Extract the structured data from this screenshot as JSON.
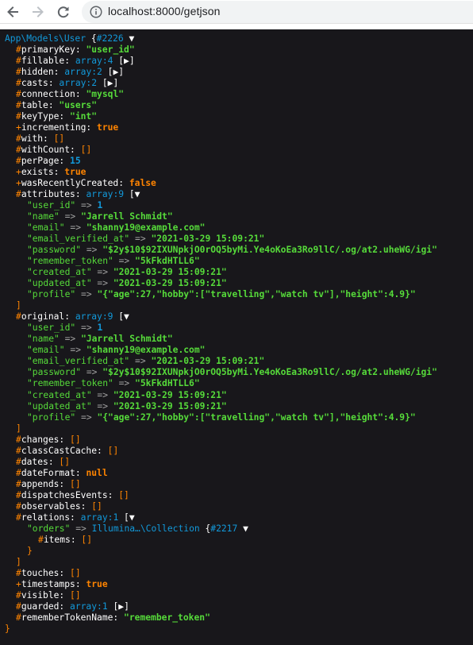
{
  "browser": {
    "url": "localhost:8000/getjson"
  },
  "colors": {
    "dump_bg": "#18171b",
    "string": "#56db3a",
    "constant": "#ff8400",
    "meta": "#1299da"
  },
  "lines": [
    {
      "i": 0,
      "s": [
        [
          "class",
          "App\\Models\\User"
        ],
        [
          "key",
          " {"
        ],
        [
          "meta",
          "#2226"
        ],
        [
          "toggle",
          " ▼"
        ]
      ]
    },
    {
      "i": 1,
      "s": [
        [
          "sym",
          "#"
        ],
        [
          "key",
          "primaryKey: "
        ],
        [
          "str",
          "\"user_id\""
        ]
      ]
    },
    {
      "i": 1,
      "s": [
        [
          "sym",
          "#"
        ],
        [
          "key",
          "fillable: "
        ],
        [
          "meta",
          "array:4"
        ],
        [
          "key",
          " ["
        ],
        [
          "toggle",
          "▶"
        ],
        [
          "key",
          "]"
        ]
      ]
    },
    {
      "i": 1,
      "s": [
        [
          "sym",
          "#"
        ],
        [
          "key",
          "hidden: "
        ],
        [
          "meta",
          "array:2"
        ],
        [
          "key",
          " ["
        ],
        [
          "toggle",
          "▶"
        ],
        [
          "key",
          "]"
        ]
      ]
    },
    {
      "i": 1,
      "s": [
        [
          "sym",
          "#"
        ],
        [
          "key",
          "casts: "
        ],
        [
          "meta",
          "array:2"
        ],
        [
          "key",
          " ["
        ],
        [
          "toggle",
          "▶"
        ],
        [
          "key",
          "]"
        ]
      ]
    },
    {
      "i": 1,
      "s": [
        [
          "sym",
          "#"
        ],
        [
          "key",
          "connection: "
        ],
        [
          "str",
          "\"mysql\""
        ]
      ]
    },
    {
      "i": 1,
      "s": [
        [
          "sym",
          "#"
        ],
        [
          "key",
          "table: "
        ],
        [
          "str",
          "\"users\""
        ]
      ]
    },
    {
      "i": 1,
      "s": [
        [
          "sym",
          "#"
        ],
        [
          "key",
          "keyType: "
        ],
        [
          "str",
          "\"int\""
        ]
      ]
    },
    {
      "i": 1,
      "s": [
        [
          "sym",
          "+"
        ],
        [
          "key",
          "incrementing: "
        ],
        [
          "const",
          "true"
        ]
      ]
    },
    {
      "i": 1,
      "s": [
        [
          "sym",
          "#"
        ],
        [
          "key",
          "with: "
        ],
        [
          "sym",
          "[]"
        ]
      ]
    },
    {
      "i": 1,
      "s": [
        [
          "sym",
          "#"
        ],
        [
          "key",
          "withCount: "
        ],
        [
          "sym",
          "[]"
        ]
      ]
    },
    {
      "i": 1,
      "s": [
        [
          "sym",
          "#"
        ],
        [
          "key",
          "perPage: "
        ],
        [
          "num",
          "15"
        ]
      ]
    },
    {
      "i": 1,
      "s": [
        [
          "sym",
          "+"
        ],
        [
          "key",
          "exists: "
        ],
        [
          "const",
          "true"
        ]
      ]
    },
    {
      "i": 1,
      "s": [
        [
          "sym",
          "+"
        ],
        [
          "key",
          "wasRecentlyCreated: "
        ],
        [
          "const",
          "false"
        ]
      ]
    },
    {
      "i": 1,
      "s": [
        [
          "sym",
          "#"
        ],
        [
          "key",
          "attributes: "
        ],
        [
          "meta",
          "array:9"
        ],
        [
          "key",
          " ["
        ],
        [
          "toggle",
          "▼"
        ]
      ]
    },
    {
      "i": 2,
      "s": [
        [
          "akey",
          "\"user_id\""
        ],
        [
          "arrow",
          " => "
        ],
        [
          "num",
          "1"
        ]
      ]
    },
    {
      "i": 2,
      "s": [
        [
          "akey",
          "\"name\""
        ],
        [
          "arrow",
          " => "
        ],
        [
          "str",
          "\"Jarrell Schmidt\""
        ]
      ]
    },
    {
      "i": 2,
      "s": [
        [
          "akey",
          "\"email\""
        ],
        [
          "arrow",
          " => "
        ],
        [
          "str",
          "\"shanny19@example.com\""
        ]
      ]
    },
    {
      "i": 2,
      "s": [
        [
          "akey",
          "\"email_verified_at\""
        ],
        [
          "arrow",
          " => "
        ],
        [
          "str",
          "\"2021-03-29 15:09:21\""
        ]
      ]
    },
    {
      "i": 2,
      "s": [
        [
          "akey",
          "\"password\""
        ],
        [
          "arrow",
          " => "
        ],
        [
          "str",
          "\"$2y$10$92IXUNpkjO0rOQ5byMi.Ye4oKoEa3Ro9llC/.og/at2.uheWG/igi\""
        ]
      ]
    },
    {
      "i": 2,
      "s": [
        [
          "akey",
          "\"remember_token\""
        ],
        [
          "arrow",
          " => "
        ],
        [
          "str",
          "\"5kFkdHTLL6\""
        ]
      ]
    },
    {
      "i": 2,
      "s": [
        [
          "akey",
          "\"created_at\""
        ],
        [
          "arrow",
          " => "
        ],
        [
          "str",
          "\"2021-03-29 15:09:21\""
        ]
      ]
    },
    {
      "i": 2,
      "s": [
        [
          "akey",
          "\"updated_at\""
        ],
        [
          "arrow",
          " => "
        ],
        [
          "str",
          "\"2021-03-29 15:09:21\""
        ]
      ]
    },
    {
      "i": 2,
      "s": [
        [
          "akey",
          "\"profile\""
        ],
        [
          "arrow",
          " => "
        ],
        [
          "str",
          "\"{\"age\":27,\"hobby\":[\"travelling\",\"watch tv\"],\"height\":4.9}\""
        ]
      ]
    },
    {
      "i": 1,
      "s": [
        [
          "sym",
          "]"
        ]
      ]
    },
    {
      "i": 1,
      "s": [
        [
          "sym",
          "#"
        ],
        [
          "key",
          "original: "
        ],
        [
          "meta",
          "array:9"
        ],
        [
          "key",
          " ["
        ],
        [
          "toggle",
          "▼"
        ]
      ]
    },
    {
      "i": 2,
      "s": [
        [
          "akey",
          "\"user_id\""
        ],
        [
          "arrow",
          " => "
        ],
        [
          "num",
          "1"
        ]
      ]
    },
    {
      "i": 2,
      "s": [
        [
          "akey",
          "\"name\""
        ],
        [
          "arrow",
          " => "
        ],
        [
          "str",
          "\"Jarrell Schmidt\""
        ]
      ]
    },
    {
      "i": 2,
      "s": [
        [
          "akey",
          "\"email\""
        ],
        [
          "arrow",
          " => "
        ],
        [
          "str",
          "\"shanny19@example.com\""
        ]
      ]
    },
    {
      "i": 2,
      "s": [
        [
          "akey",
          "\"email_verified_at\""
        ],
        [
          "arrow",
          " => "
        ],
        [
          "str",
          "\"2021-03-29 15:09:21\""
        ]
      ]
    },
    {
      "i": 2,
      "s": [
        [
          "akey",
          "\"password\""
        ],
        [
          "arrow",
          " => "
        ],
        [
          "str",
          "\"$2y$10$92IXUNpkjO0rOQ5byMi.Ye4oKoEa3Ro9llC/.og/at2.uheWG/igi\""
        ]
      ]
    },
    {
      "i": 2,
      "s": [
        [
          "akey",
          "\"remember_token\""
        ],
        [
          "arrow",
          " => "
        ],
        [
          "str",
          "\"5kFkdHTLL6\""
        ]
      ]
    },
    {
      "i": 2,
      "s": [
        [
          "akey",
          "\"created_at\""
        ],
        [
          "arrow",
          " => "
        ],
        [
          "str",
          "\"2021-03-29 15:09:21\""
        ]
      ]
    },
    {
      "i": 2,
      "s": [
        [
          "akey",
          "\"updated_at\""
        ],
        [
          "arrow",
          " => "
        ],
        [
          "str",
          "\"2021-03-29 15:09:21\""
        ]
      ]
    },
    {
      "i": 2,
      "s": [
        [
          "akey",
          "\"profile\""
        ],
        [
          "arrow",
          " => "
        ],
        [
          "str",
          "\"{\"age\":27,\"hobby\":[\"travelling\",\"watch tv\"],\"height\":4.9}\""
        ]
      ]
    },
    {
      "i": 1,
      "s": [
        [
          "sym",
          "]"
        ]
      ]
    },
    {
      "i": 1,
      "s": [
        [
          "sym",
          "#"
        ],
        [
          "key",
          "changes: "
        ],
        [
          "sym",
          "[]"
        ]
      ]
    },
    {
      "i": 1,
      "s": [
        [
          "sym",
          "#"
        ],
        [
          "key",
          "classCastCache: "
        ],
        [
          "sym",
          "[]"
        ]
      ]
    },
    {
      "i": 1,
      "s": [
        [
          "sym",
          "#"
        ],
        [
          "key",
          "dates: "
        ],
        [
          "sym",
          "[]"
        ]
      ]
    },
    {
      "i": 1,
      "s": [
        [
          "sym",
          "#"
        ],
        [
          "key",
          "dateFormat: "
        ],
        [
          "const",
          "null"
        ]
      ]
    },
    {
      "i": 1,
      "s": [
        [
          "sym",
          "#"
        ],
        [
          "key",
          "appends: "
        ],
        [
          "sym",
          "[]"
        ]
      ]
    },
    {
      "i": 1,
      "s": [
        [
          "sym",
          "#"
        ],
        [
          "key",
          "dispatchesEvents: "
        ],
        [
          "sym",
          "[]"
        ]
      ]
    },
    {
      "i": 1,
      "s": [
        [
          "sym",
          "#"
        ],
        [
          "key",
          "observables: "
        ],
        [
          "sym",
          "[]"
        ]
      ]
    },
    {
      "i": 1,
      "s": [
        [
          "sym",
          "#"
        ],
        [
          "key",
          "relations: "
        ],
        [
          "meta",
          "array:1"
        ],
        [
          "key",
          " ["
        ],
        [
          "toggle",
          "▼"
        ]
      ]
    },
    {
      "i": 2,
      "s": [
        [
          "akey",
          "\"orders\""
        ],
        [
          "arrow",
          " => "
        ],
        [
          "class",
          "Illumina…\\Collection"
        ],
        [
          "key",
          " {"
        ],
        [
          "meta",
          "#2217"
        ],
        [
          "toggle",
          " ▼"
        ]
      ]
    },
    {
      "i": 3,
      "s": [
        [
          "sym",
          "#"
        ],
        [
          "key",
          "items: "
        ],
        [
          "sym",
          "[]"
        ]
      ]
    },
    {
      "i": 2,
      "s": [
        [
          "sym",
          "}"
        ]
      ]
    },
    {
      "i": 1,
      "s": [
        [
          "sym",
          "]"
        ]
      ]
    },
    {
      "i": 1,
      "s": [
        [
          "sym",
          "#"
        ],
        [
          "key",
          "touches: "
        ],
        [
          "sym",
          "[]"
        ]
      ]
    },
    {
      "i": 1,
      "s": [
        [
          "sym",
          "+"
        ],
        [
          "key",
          "timestamps: "
        ],
        [
          "const",
          "true"
        ]
      ]
    },
    {
      "i": 1,
      "s": [
        [
          "sym",
          "#"
        ],
        [
          "key",
          "visible: "
        ],
        [
          "sym",
          "[]"
        ]
      ]
    },
    {
      "i": 1,
      "s": [
        [
          "sym",
          "#"
        ],
        [
          "key",
          "guarded: "
        ],
        [
          "meta",
          "array:1"
        ],
        [
          "key",
          " ["
        ],
        [
          "toggle",
          "▶"
        ],
        [
          "key",
          "]"
        ]
      ]
    },
    {
      "i": 1,
      "s": [
        [
          "sym",
          "#"
        ],
        [
          "key",
          "rememberTokenName: "
        ],
        [
          "str",
          "\"remember_token\""
        ]
      ]
    },
    {
      "i": 0,
      "s": [
        [
          "sym",
          "}"
        ]
      ]
    }
  ]
}
